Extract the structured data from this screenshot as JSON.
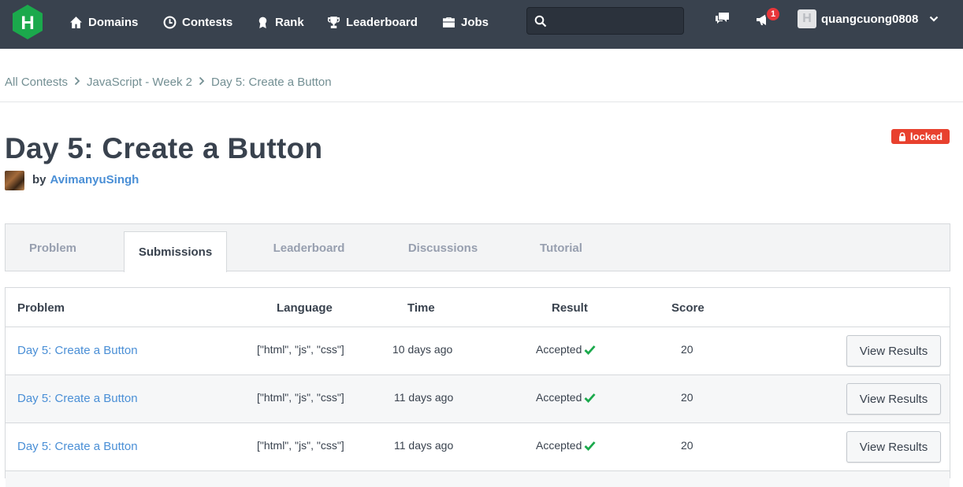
{
  "nav": {
    "items": [
      {
        "label": "Domains",
        "icon": "home-icon"
      },
      {
        "label": "Contests",
        "icon": "clock-icon"
      },
      {
        "label": "Rank",
        "icon": "medal-icon"
      },
      {
        "label": "Leaderboard",
        "icon": "trophy-icon"
      },
      {
        "label": "Jobs",
        "icon": "briefcase-icon"
      }
    ],
    "search_value": "",
    "notification_count": "1",
    "username": "quangcuong0808"
  },
  "breadcrumb": {
    "items": [
      "All Contests",
      "JavaScript - Week 2"
    ],
    "current": "Day 5: Create a Button"
  },
  "challenge": {
    "title": "Day 5: Create a Button",
    "status": "locked",
    "by_label": "by",
    "author": "AvimanyuSingh"
  },
  "tabs": [
    "Problem",
    "Submissions",
    "Leaderboard",
    "Discussions",
    "Tutorial"
  ],
  "active_tab": "Submissions",
  "table": {
    "headers": {
      "problem": "Problem",
      "language": "Language",
      "time": "Time",
      "result": "Result",
      "score": "Score"
    },
    "rows": [
      {
        "problem": "Day 5: Create a Button",
        "language": "[\"html\", \"js\", \"css\"]",
        "time": "10 days ago",
        "result": "Accepted",
        "score": "20",
        "action": "View Results"
      },
      {
        "problem": "Day 5: Create a Button",
        "language": "[\"html\", \"js\", \"css\"]",
        "time": "11 days ago",
        "result": "Accepted",
        "score": "20",
        "action": "View Results"
      },
      {
        "problem": "Day 5: Create a Button",
        "language": "[\"html\", \"js\", \"css\"]",
        "time": "11 days ago",
        "result": "Accepted",
        "score": "20",
        "action": "View Results"
      }
    ]
  },
  "colors": {
    "navbar": "#39424e",
    "brand": "#1ba94c",
    "link": "#4a8fd6",
    "locked": "#e8412e",
    "accepted": "#1ba94c"
  }
}
